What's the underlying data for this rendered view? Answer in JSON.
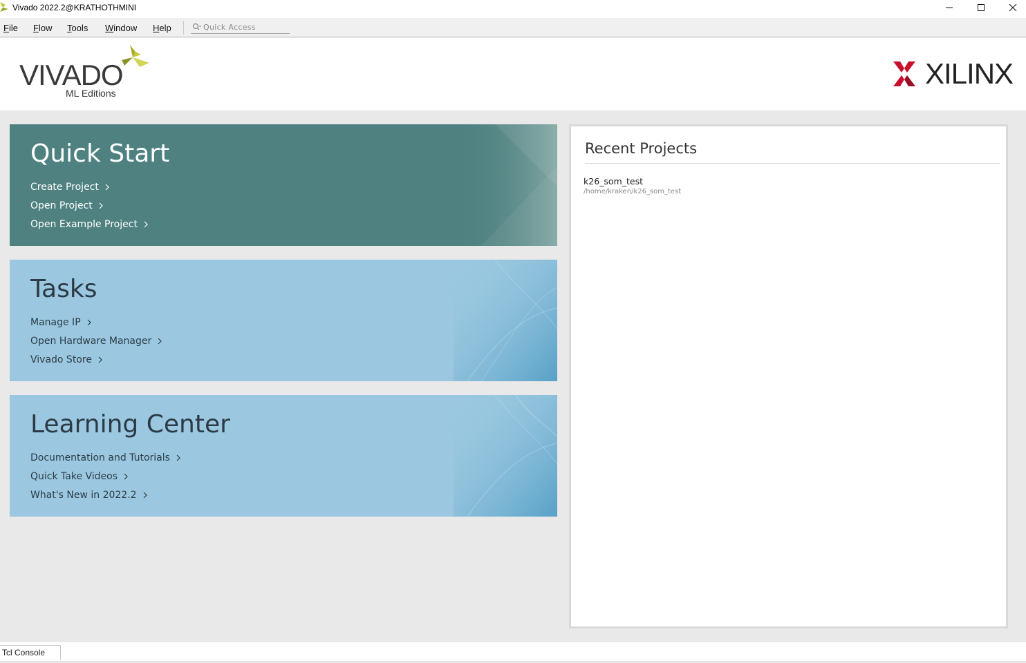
{
  "window": {
    "title": "Vivado 2022.2@KRATHOTHMINI",
    "controls": [
      "minimize-icon",
      "maximize-icon",
      "close-icon"
    ]
  },
  "menu": {
    "items": [
      {
        "label_ul": "F",
        "label_rest": "ile"
      },
      {
        "label_ul": "F",
        "label_rest": "low"
      },
      {
        "label_ul": "T",
        "label_rest": "ools"
      },
      {
        "label_ul": "W",
        "label_rest": "indow"
      },
      {
        "label_ul": "H",
        "label_rest": "elp"
      }
    ],
    "quick_access_placeholder": "Quick Access"
  },
  "header": {
    "vivado_word": "VIVADO",
    "vivado_sub": "ML Editions",
    "xilinx_word": "XILINX"
  },
  "quick_start": {
    "title": "Quick Start",
    "links": [
      "Create Project",
      "Open Project",
      "Open Example Project"
    ]
  },
  "tasks": {
    "title": "Tasks",
    "links": [
      "Manage IP",
      "Open Hardware Manager",
      "Vivado Store"
    ]
  },
  "learning_center": {
    "title": "Learning Center",
    "links": [
      "Documentation and Tutorials",
      "Quick Take Videos",
      "What's New in 2022.2"
    ]
  },
  "recent_projects": {
    "title": "Recent Projects",
    "items": [
      {
        "name": "k26_som_test",
        "path": "/home/kraken/k26_som_test"
      }
    ]
  },
  "bottom": {
    "tcl_console_label": "Tcl Console"
  },
  "colors": {
    "quick_start_bg": "#4e8180",
    "tasks_bg": "#9bc8e0",
    "xilinx_red": "#c8102e",
    "vivado_mark": "#c4c836"
  }
}
